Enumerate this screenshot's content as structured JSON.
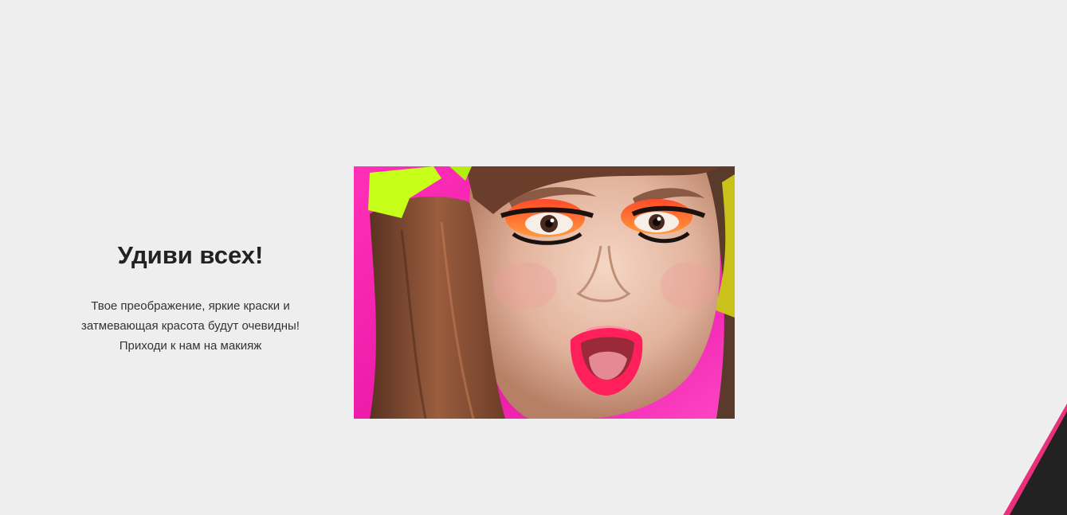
{
  "promo": {
    "headline": "Удиви всех!",
    "body_lines": [
      "Твое преображение, яркие краски и",
      "затмевающая красота будут очевидны!",
      "Приходи к нам на макияж"
    ],
    "image_icon": "makeup-photo",
    "background_color": "#eeeeee",
    "accent_color": "#e8317a",
    "corner_color": "#222222"
  }
}
